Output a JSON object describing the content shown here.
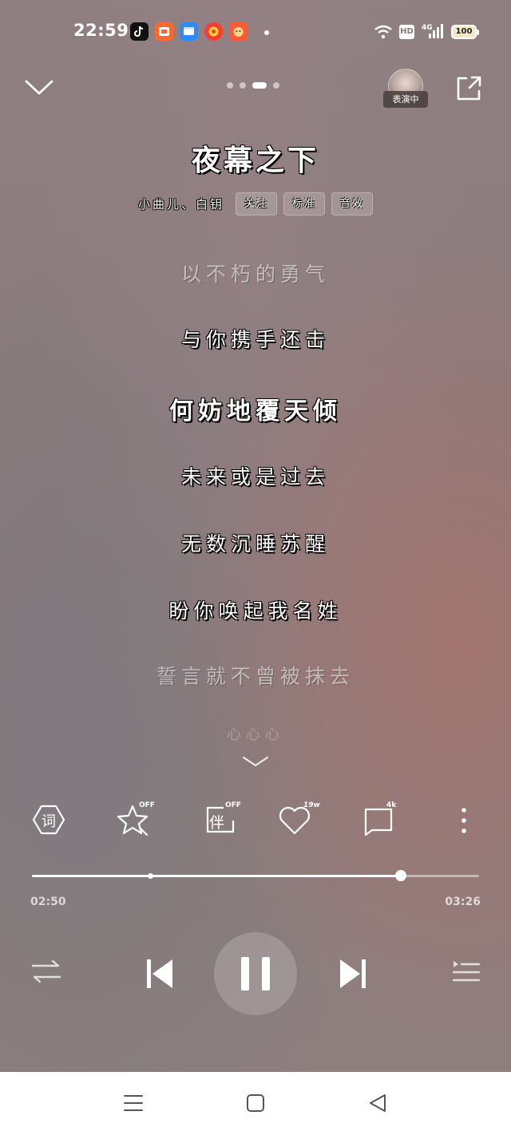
{
  "status_bar": {
    "time": "22:59",
    "app_icons": [
      "tiktok-icon",
      "taobao-icon",
      "message-icon",
      "weibo-icon",
      "game-icon"
    ],
    "network": "4G",
    "hd_label": "HD",
    "battery": "100"
  },
  "header": {
    "pager_count": 4,
    "pager_active": 2,
    "avatar_label": "表演中"
  },
  "song": {
    "title": "夜幕之下",
    "artists": "小曲儿、白钥",
    "chips": [
      "关注",
      "标准",
      "音效"
    ]
  },
  "lyrics": [
    {
      "text": "以不朽的勇气",
      "state": "dim"
    },
    {
      "text": "与你携手还击",
      "state": "normal"
    },
    {
      "text": "何妨地覆天倾",
      "state": "current"
    },
    {
      "text": "未来或是过去",
      "state": "normal"
    },
    {
      "text": "无数沉睡苏醒",
      "state": "normal"
    },
    {
      "text": "盼你唤起我名姓",
      "state": "normal"
    },
    {
      "text": "誓言就不曾被抹去",
      "state": "dim"
    },
    {
      "text": "心心心",
      "state": "faded"
    }
  ],
  "actions": {
    "lyrics_label": "词",
    "fav_badge": "OFF",
    "accompany_label": "伴",
    "accompany_badge": "OFF",
    "like_count": "19w",
    "comment_count": "4k"
  },
  "playback": {
    "current_time": "02:50",
    "total_time": "03:26",
    "progress": 0.825,
    "mark": 0.265
  },
  "colors": {
    "accent": "#ffffff",
    "background": "#8c7d7e"
  }
}
